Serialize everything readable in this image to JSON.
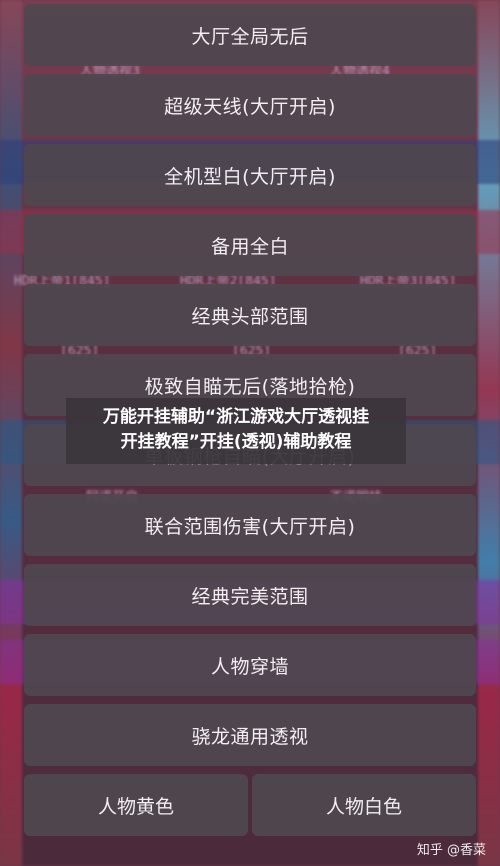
{
  "background": {
    "labels": [
      "人物透视3",
      "人物透视4",
      "HDR上帝1[845]",
      "HDR上帝2[845]",
      "HDR上帝3[845]",
      "[625]",
      "[625]",
      "[625]",
      "阿诺开启",
      "不诺明挂"
    ]
  },
  "menu": {
    "items": [
      "大厅全局无后",
      "超级天线(大厅开启)",
      "全机型白(大厅开启)",
      "备用全白",
      "经典头部范围",
      "极致自瞄无后(落地拾枪)",
      "单板钢枪自瞄(大厅开启)",
      "联合范围伤害(大厅开启)",
      "经典完美范围",
      "人物穿墙",
      "骁龙通用透视"
    ],
    "bottom_row": [
      "人物黄色",
      "人物白色"
    ]
  },
  "overlay": {
    "title_line1": "万能开挂辅助“浙江游戏大厅透视挂",
    "title_line2": "开挂教程”开挂(透视)辅助教程"
  },
  "watermark": "知乎 @香菜"
}
